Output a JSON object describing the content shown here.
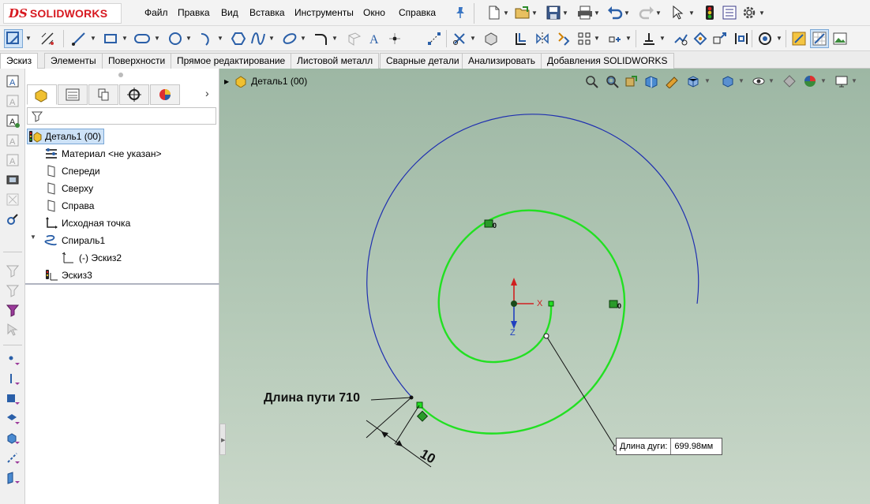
{
  "app": {
    "logo_ds": "DS",
    "logo_name": "SOLIDWORKS"
  },
  "menu": [
    "Файл",
    "Правка",
    "Вид",
    "Вставка",
    "Инструменты",
    "Окно",
    "Справка"
  ],
  "tabs": [
    "Эскиз",
    "Элементы",
    "Поверхности",
    "Прямое редактирование",
    "Листовой металл",
    "Сварные детали",
    "Анализировать",
    "Добавления SOLIDWORKS"
  ],
  "feature_tree": {
    "root": "Деталь1  (00)",
    "items": [
      {
        "label": "Материал <не указан>",
        "icon": "material-icon"
      },
      {
        "label": "Спереди",
        "icon": "plane-icon"
      },
      {
        "label": "Сверху",
        "icon": "plane-icon"
      },
      {
        "label": "Справа",
        "icon": "plane-icon"
      },
      {
        "label": "Исходная точка",
        "icon": "origin-icon"
      },
      {
        "label": "Спираль1",
        "icon": "helix-icon"
      },
      {
        "label": "(-) Эскиз2",
        "icon": "sketch-icon"
      },
      {
        "label": "Эскиз3",
        "icon": "sketch-icon"
      }
    ]
  },
  "viewport": {
    "breadcrumb": "Деталь1  (00)",
    "path_length_label": "Длина пути 710",
    "dimension_value": "10",
    "arc_length_label": "Длина дуги:",
    "arc_length_value": "699.98мм",
    "axis_x": "X",
    "axis_z": "Z",
    "relation_marks": [
      "0",
      "0"
    ]
  },
  "colors": {
    "helix_blue": "#1f2fb0",
    "sketch_green": "#22e022",
    "accent_red": "#d71920",
    "viewport_top": "#9db7a4",
    "viewport_bottom": "#c9d7c9"
  }
}
